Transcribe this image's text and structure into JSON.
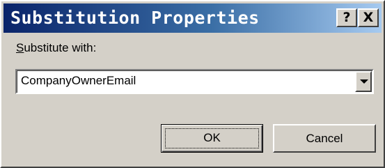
{
  "window": {
    "title": "Substitution Properties",
    "help_label": "?",
    "close_label": "X"
  },
  "form": {
    "field_label_mnemonic": "S",
    "field_label_rest": "ubstitute with:",
    "field_value": "CompanyOwnerEmail"
  },
  "buttons": {
    "ok_label": "OK",
    "cancel_label": "Cancel"
  },
  "icons": {
    "dropdown": "chevron-down-icon"
  },
  "colors": {
    "face": "#d4d0c8",
    "title_start": "#0a246a",
    "title_end": "#a6caf0"
  }
}
